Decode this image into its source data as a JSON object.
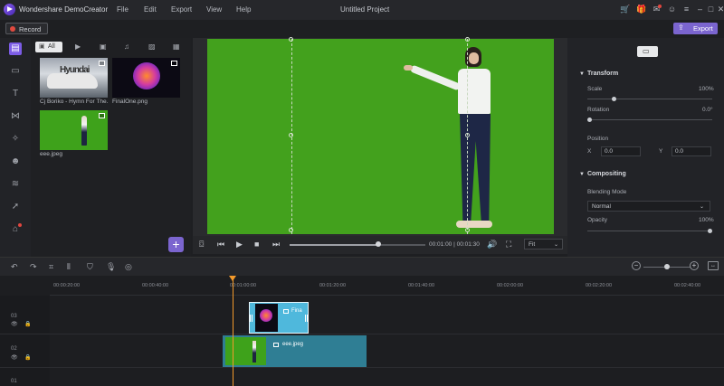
{
  "app": {
    "title": "Wondershare DemoCreator",
    "project_title": "Untitled Project",
    "menu": [
      "File",
      "Edit",
      "Export",
      "View",
      "Help"
    ]
  },
  "titlebar_icons": [
    "cart-icon",
    "gift-icon",
    "mail-icon",
    "user-icon",
    "menu-icon",
    "minimize-icon",
    "maximize-icon",
    "close-icon"
  ],
  "toolbar": {
    "record_label": "Record",
    "export_label": "Export"
  },
  "left_rail": [
    "media-library-icon",
    "annotation-icon",
    "captions-icon",
    "transitions-icon",
    "effects-icon",
    "stickers-icon",
    "audio-icon",
    "cursor-effects-icon",
    "store-icon"
  ],
  "media": {
    "filter_all_label": "All",
    "filter_icons": [
      "video-filter-icon",
      "screen-filter-icon",
      "audio-filter-icon",
      "image-filter-icon",
      "grid-filter-icon"
    ],
    "items": [
      {
        "label": "Cj Boriko - Hymn For The...",
        "overlay_text": "Hyundai",
        "type": "video"
      },
      {
        "label": "FinalOne.png",
        "type": "image"
      },
      {
        "label": "eee.jpeg",
        "type": "image"
      }
    ]
  },
  "player": {
    "time": "00:01:00 | 00:01:30",
    "zoom": "Fit",
    "progress": 0.65
  },
  "properties": {
    "transform_header": "Transform",
    "scale_label": "Scale",
    "scale_value": "100%",
    "scale_fraction": 0.2,
    "rotation_label": "Rotation",
    "rotation_value": "0.0°",
    "position_label": "Position",
    "x_label": "X",
    "x_value": "0.0",
    "y_label": "Y",
    "y_value": "0.0",
    "compositing_header": "Compositing",
    "blending_label": "Blending Mode",
    "blending_value": "Normal",
    "opacity_label": "Opacity",
    "opacity_value": "100%"
  },
  "timeline": {
    "ticks": [
      "00:00:20:00",
      "00:00:40:00",
      "00:01:00:00",
      "00:01:20:00",
      "00:01:40:00",
      "00:02:00:00",
      "00:02:20:00",
      "00:02:40:00"
    ],
    "tracks": [
      "03",
      "02",
      "01"
    ],
    "clips": [
      {
        "label": "Fina",
        "track": "03"
      },
      {
        "label": "eee.jpeg",
        "track": "02"
      }
    ]
  },
  "colors": {
    "accent": "#7b65cf",
    "green_screen": "#43a11d",
    "playhead": "#f39a2b",
    "clip_image": "#2f7e94",
    "clip_final": "#4fb8dc"
  }
}
